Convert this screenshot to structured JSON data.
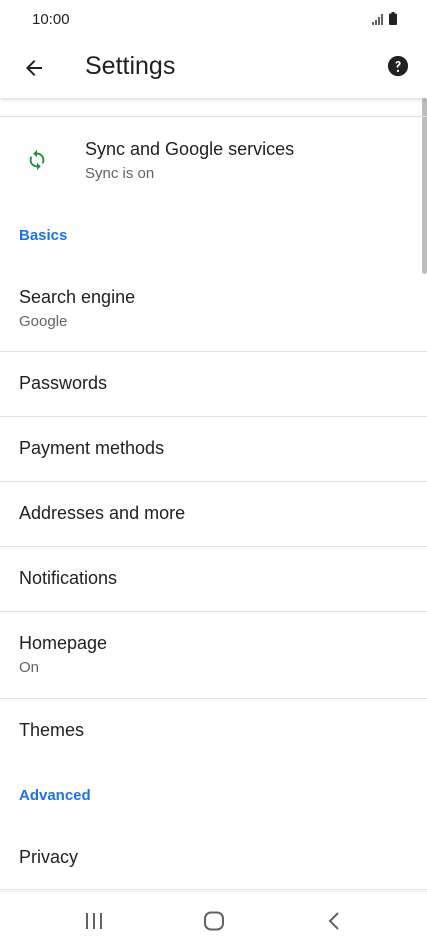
{
  "status_bar": {
    "time": "10:00"
  },
  "app_bar": {
    "title": "Settings",
    "back_icon": "arrow-back-icon",
    "help_icon": "help-icon"
  },
  "sync": {
    "title": "Sync and Google services",
    "subtitle": "Sync is on",
    "icon": "sync-icon",
    "icon_color": "#1e8e3e"
  },
  "sections": {
    "basics": "Basics",
    "advanced": "Advanced"
  },
  "items": {
    "search_engine": {
      "title": "Search engine",
      "subtitle": "Google"
    },
    "passwords": {
      "title": "Passwords"
    },
    "payment_methods": {
      "title": "Payment methods"
    },
    "addresses": {
      "title": "Addresses and more"
    },
    "notifications": {
      "title": "Notifications"
    },
    "homepage": {
      "title": "Homepage",
      "subtitle": "On"
    },
    "themes": {
      "title": "Themes"
    },
    "privacy": {
      "title": "Privacy"
    }
  },
  "nav_bar": {
    "recents_icon": "recents-icon",
    "home_icon": "home-icon",
    "back_icon": "back-chevron-icon"
  },
  "colors": {
    "accent": "#1a73e8",
    "text_primary": "#202124",
    "text_secondary": "#5f6368",
    "sync_green": "#1e8e3e"
  }
}
